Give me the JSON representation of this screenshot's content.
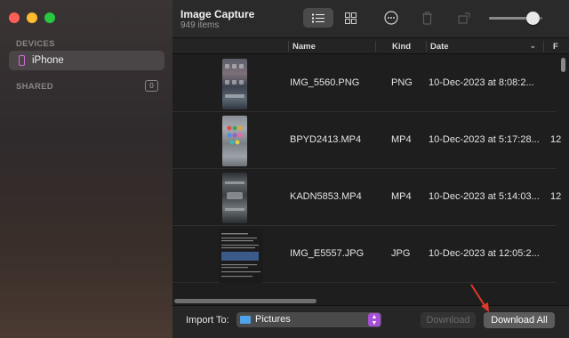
{
  "window": {
    "title": "Image Capture",
    "subtitle": "949 items"
  },
  "sidebar": {
    "devices_label": "DEVICES",
    "device": {
      "label": "iPhone",
      "icon": "iphone-icon"
    },
    "shared_label": "SHARED",
    "shared_count": "0"
  },
  "toolbar": {
    "list_view_icon": "list-view-icon",
    "grid_view_icon": "grid-view-icon",
    "more_icon": "ellipsis-circle-icon",
    "delete_icon": "trash-icon",
    "rotate_icon": "rotate-icon",
    "thumbnail_size_slider": 0.82
  },
  "table": {
    "columns": {
      "name": "Name",
      "kind": "Kind",
      "date": "Date",
      "extra": "F"
    },
    "rows": [
      {
        "name": "IMG_5560.PNG",
        "kind": "PNG",
        "date": "10-Dec-2023 at 8:08:2...",
        "extra": ""
      },
      {
        "name": "BPYD2413.MP4",
        "kind": "MP4",
        "date": "10-Dec-2023 at 5:17:28...",
        "extra": "12"
      },
      {
        "name": "KADN5853.MP4",
        "kind": "MP4",
        "date": "10-Dec-2023 at 5:14:03...",
        "extra": "12"
      },
      {
        "name": "IMG_E5557.JPG",
        "kind": "JPG",
        "date": "10-Dec-2023 at 12:05:2...",
        "extra": ""
      }
    ]
  },
  "bottom": {
    "import_to_label": "Import To:",
    "import_destination": "Pictures",
    "download_label": "Download",
    "download_all_label": "Download All"
  },
  "colors": {
    "accent_purple": "#a64fd6",
    "folder_blue": "#4fa3e8",
    "annotation_red": "#e0382b"
  }
}
